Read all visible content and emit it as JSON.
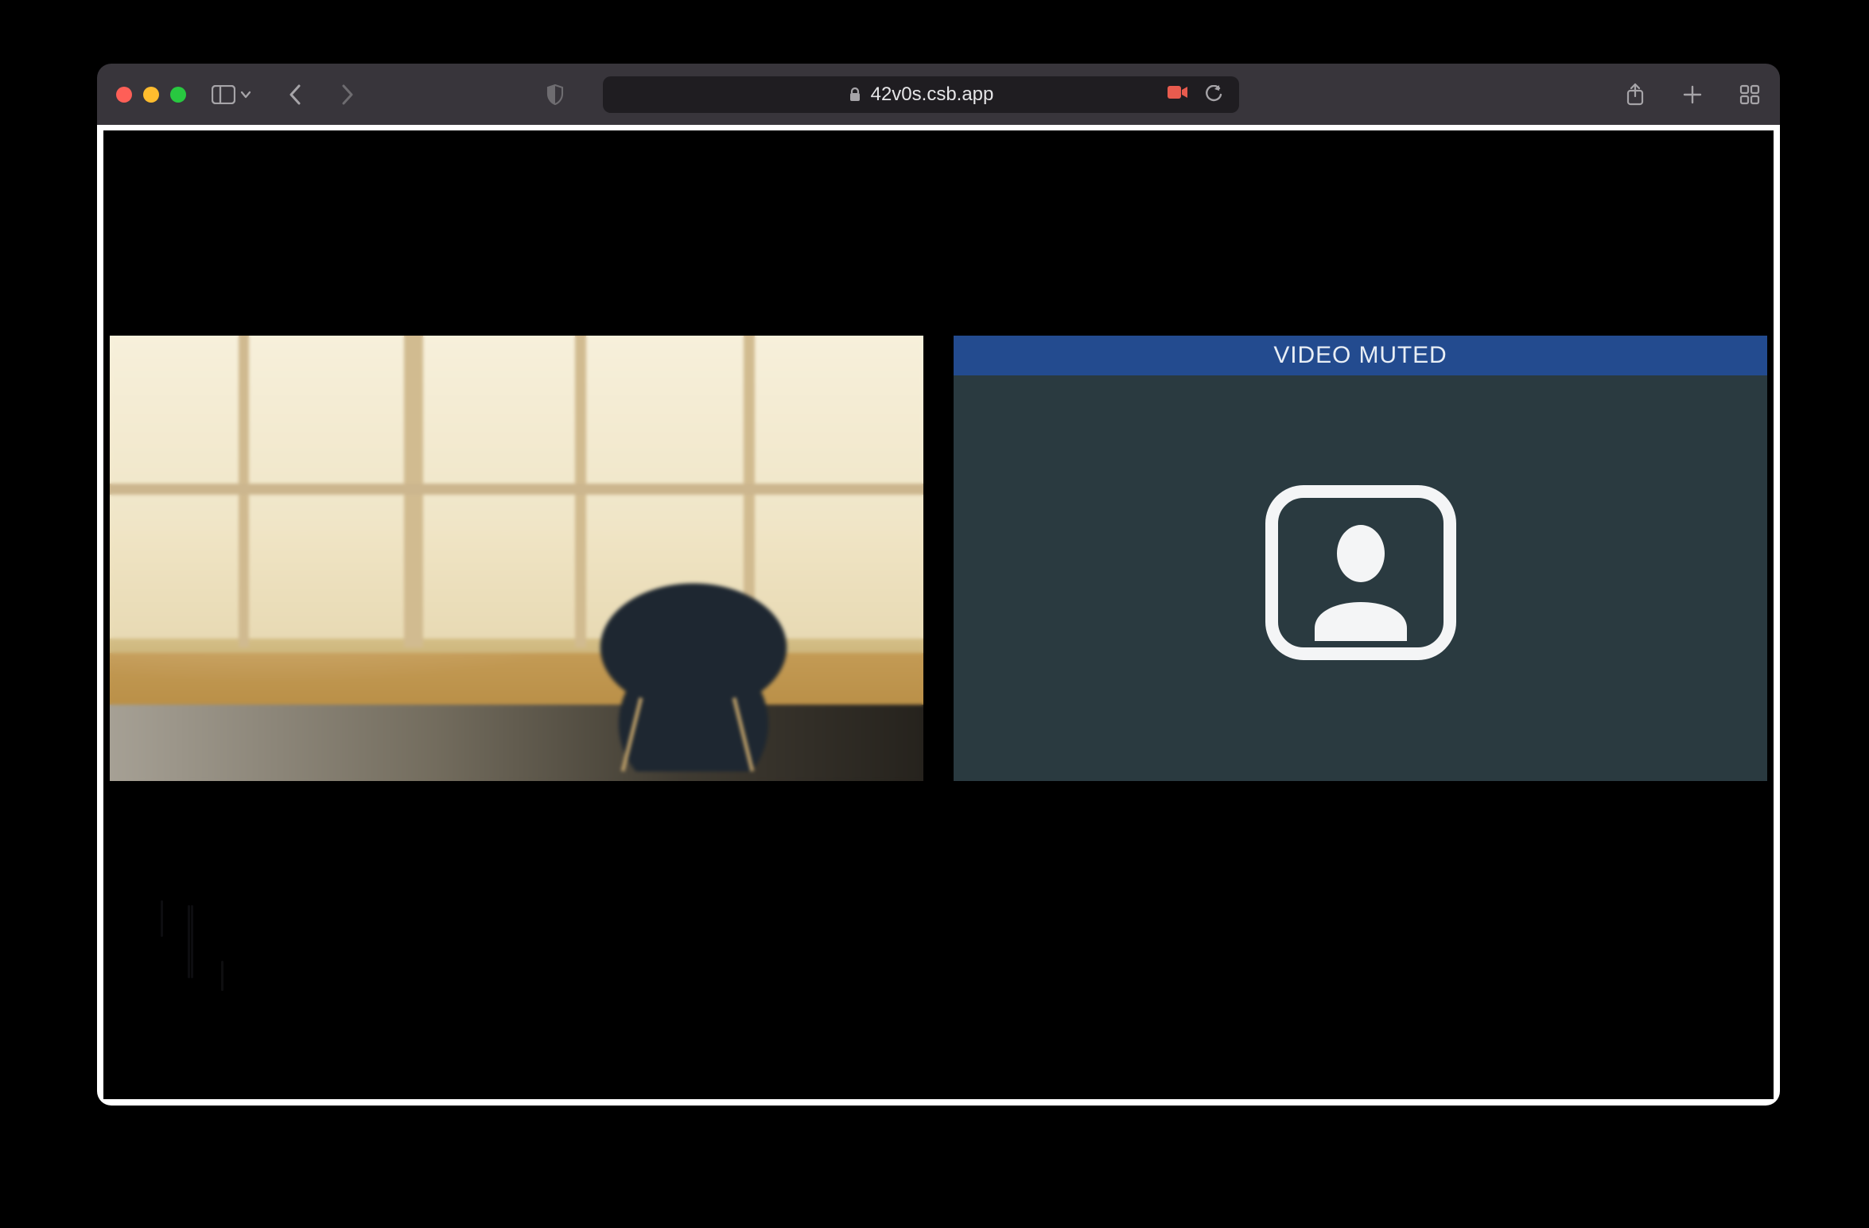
{
  "browser": {
    "url_display": "42v0s.csb.app",
    "secure": true,
    "recording": true
  },
  "page": {
    "tiles": {
      "left": {
        "type": "live-video",
        "description": "camera feed of a sunlit room with window, table and chair"
      },
      "right": {
        "type": "muted-video",
        "banner_label": "VIDEO MUTED",
        "avatar_icon": "user-silhouette-icon"
      }
    }
  },
  "colors": {
    "muted_banner": "#234b8f",
    "tile_dark": "#2a3a40"
  }
}
